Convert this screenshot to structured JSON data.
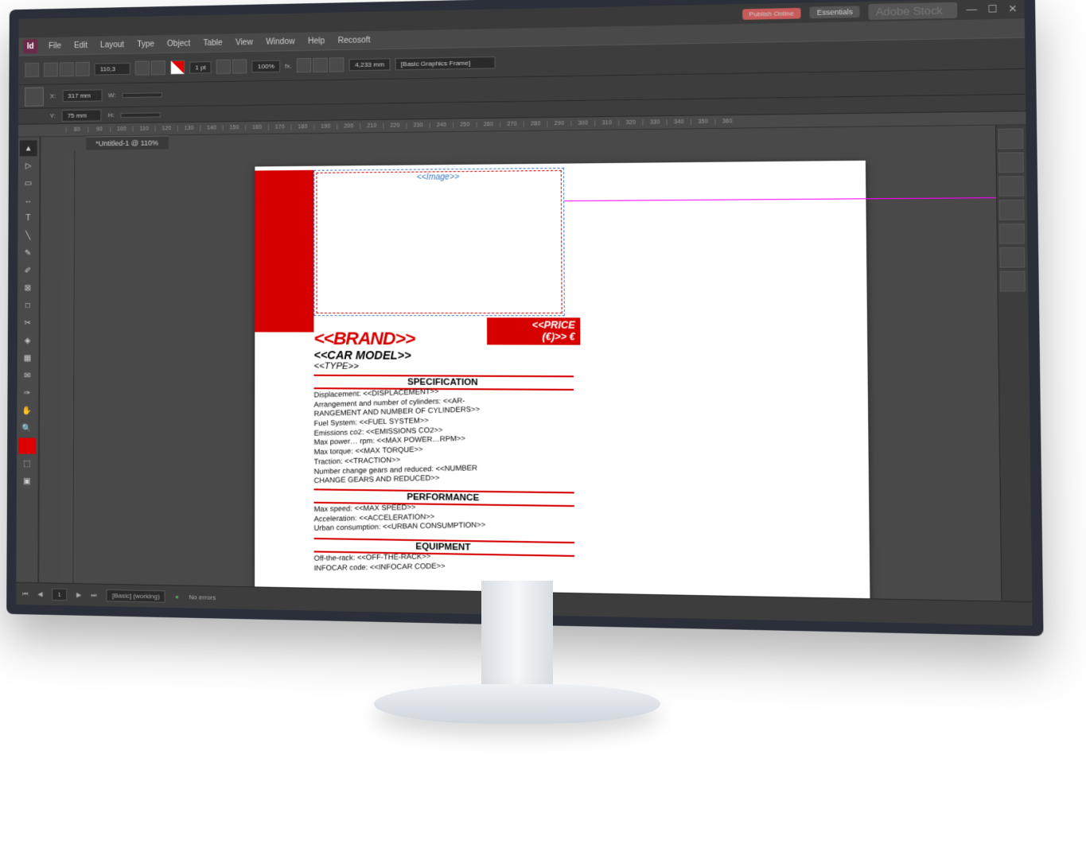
{
  "titlebar": {
    "publish": "Publish Online",
    "workspace": "Essentials",
    "search_placeholder": "Adobe Stock"
  },
  "menu": {
    "file": "File",
    "edit": "Edit",
    "layout": "Layout",
    "type": "Type",
    "object": "Object",
    "table": "Table",
    "view": "View",
    "window": "Window",
    "help": "Help",
    "recosoft": "Recosoft"
  },
  "control": {
    "zoom": "110,3",
    "stroke": "1 pt",
    "opacity": "100%",
    "fx": "fx.",
    "dim": "4,233 mm",
    "style": "[Basic Graphics Frame]"
  },
  "options": {
    "x_label": "X:",
    "x": "317 mm",
    "y_label": "Y:",
    "y": "75 mm",
    "w_label": "W:",
    "h_label": "H:"
  },
  "ruler": [
    "80",
    "90",
    "100",
    "110",
    "120",
    "130",
    "140",
    "150",
    "160",
    "170",
    "180",
    "190",
    "200",
    "210",
    "220",
    "230",
    "240",
    "250",
    "260",
    "270",
    "280",
    "290",
    "300",
    "310",
    "320",
    "330",
    "340",
    "350",
    "360"
  ],
  "tab": "*Untitled-1 @ 110%",
  "doc": {
    "image": "<<Image>>",
    "price_line1": "<<PRICE",
    "price_line2": "(€)>> €",
    "brand": "<<BRAND>>",
    "model": "<<CAR MODEL>>",
    "type": "<<TYPE>>",
    "spec_title": "SPECIFICATION",
    "spec_body": "Displacement: <<DISPLACEMENT>>\nArrangement and number of cylinders: <<AR-\nRANGEMENT AND NUMBER OF CYLINDERS>>\nFuel System: <<FUEL SYSTEM>>\nEmissions co2: <<EMISSIONS CO2>>\nMax power… rpm: <<MAX POWER…RPM>>\nMax torque: <<MAX TORQUE>>\nTraction: <<TRACTION>>\nNumber change gears and reduced: <<NUMBER\nCHANGE GEARS AND REDUCED>>",
    "perf_title": "PERFORMANCE",
    "perf_body": "Max speed: <<MAX SPEED>>\nAcceleration: <<ACCELERATION>>\nUrban consumption: <<URBAN CONSUMPTION>>",
    "equip_title": "EQUIPMENT",
    "equip_body": "Off-the-rack: <<OFF-THE-RACK>>\nINFOCAR code: <<INFOCAR CODE>>"
  },
  "status": {
    "page": "1",
    "preflight": "No errors",
    "style": "[Basic] (working)"
  }
}
